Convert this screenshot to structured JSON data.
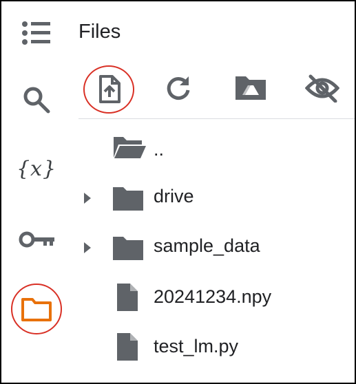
{
  "panel": {
    "title": "Files"
  },
  "rail": {
    "items": [
      {
        "name": "table-of-contents",
        "icon": "toc-icon"
      },
      {
        "name": "find",
        "icon": "search-icon"
      },
      {
        "name": "variables",
        "icon": "variables-icon",
        "glyph": "{x}"
      },
      {
        "name": "secrets",
        "icon": "key-icon"
      },
      {
        "name": "files",
        "icon": "folder-icon",
        "selected": true
      }
    ]
  },
  "toolbar": {
    "buttons": [
      {
        "name": "upload",
        "icon": "upload-icon",
        "highlighted": true
      },
      {
        "name": "refresh",
        "icon": "refresh-icon"
      },
      {
        "name": "mount-drive",
        "icon": "drive-folder-icon"
      },
      {
        "name": "toggle-hidden",
        "icon": "eye-off-icon"
      }
    ]
  },
  "files": [
    {
      "label": "..",
      "type": "parent",
      "icon": "open-folder-icon"
    },
    {
      "label": "drive",
      "type": "folder",
      "expandable": true,
      "icon": "folder-icon"
    },
    {
      "label": "sample_data",
      "type": "folder",
      "expandable": true,
      "icon": "folder-icon"
    },
    {
      "label": "20241234.npy",
      "type": "file",
      "icon": "file-icon"
    },
    {
      "label": "test_lm.py",
      "type": "file",
      "icon": "file-icon"
    }
  ],
  "colors": {
    "icon_gray": "#5f6368",
    "folder_gray": "#5f6368",
    "accent_orange": "#e8710a",
    "highlight_red": "#d93025",
    "text": "#202124"
  }
}
